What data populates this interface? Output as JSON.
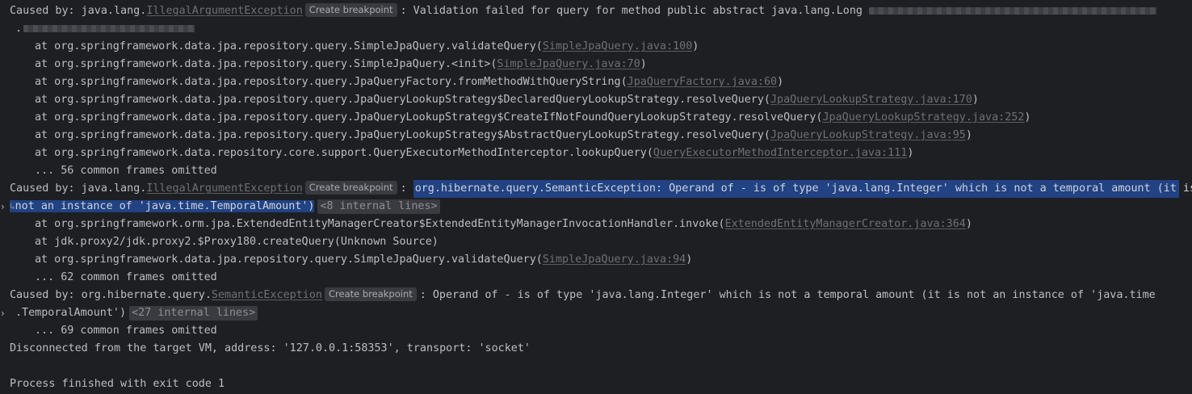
{
  "console": {
    "lines": [
      {
        "kind": "caused",
        "prefix": "Caused by: java.lang.",
        "exception": "IllegalArgumentException",
        "chip": "Create breakpoint",
        "message": ": Validation failed for query for method public abstract java.lang.Long"
      },
      {
        "kind": "cont",
        "text": "."
      },
      {
        "kind": "frame",
        "text": "at org.springframework.data.jpa.repository.query.SimpleJpaQuery.validateQuery(",
        "link": "SimpleJpaQuery.java:100",
        "suffix": ")"
      },
      {
        "kind": "frame",
        "text": "at org.springframework.data.jpa.repository.query.SimpleJpaQuery.<init>(",
        "link": "SimpleJpaQuery.java:70",
        "suffix": ")"
      },
      {
        "kind": "frame",
        "text": "at org.springframework.data.jpa.repository.query.JpaQueryFactory.fromMethodWithQueryString(",
        "link": "JpaQueryFactory.java:60",
        "suffix": ")"
      },
      {
        "kind": "frame",
        "text": "at org.springframework.data.jpa.repository.query.JpaQueryLookupStrategy$DeclaredQueryLookupStrategy.resolveQuery(",
        "link": "JpaQueryLookupStrategy.java:170",
        "suffix": ")"
      },
      {
        "kind": "frame",
        "text": "at org.springframework.data.jpa.repository.query.JpaQueryLookupStrategy$CreateIfNotFoundQueryLookupStrategy.resolveQuery(",
        "link": "JpaQueryLookupStrategy.java:252",
        "suffix": ")"
      },
      {
        "kind": "frame",
        "text": "at org.springframework.data.jpa.repository.query.JpaQueryLookupStrategy$AbstractQueryLookupStrategy.resolveQuery(",
        "link": "JpaQueryLookupStrategy.java:95",
        "suffix": ")"
      },
      {
        "kind": "frame",
        "text": "at org.springframework.data.repository.core.support.QueryExecutorMethodInterceptor.lookupQuery(",
        "link": "QueryExecutorMethodInterceptor.java:111",
        "suffix": ")"
      },
      {
        "kind": "omitted",
        "text": "... 56 common frames omitted"
      },
      {
        "kind": "caused-selected",
        "prefix": "Caused by: java.lang.",
        "exception": "IllegalArgumentException",
        "chip": "Create breakpoint",
        "colon": ":",
        "message": "org.hibernate.query.SemanticException: Operand of - is of type 'java.lang.Integer' which is not a temporal amount (it is"
      },
      {
        "kind": "cont-selected",
        "text": "not an instance of 'java.time.TemporalAmount')",
        "internal": "<8 internal lines>"
      },
      {
        "kind": "frame",
        "text": "at org.springframework.orm.jpa.ExtendedEntityManagerCreator$ExtendedEntityManagerInvocationHandler.invoke(",
        "link": "ExtendedEntityManagerCreator.java:364",
        "suffix": ")"
      },
      {
        "kind": "frame-plain",
        "text": "at jdk.proxy2/jdk.proxy2.$Proxy180.createQuery(Unknown Source)"
      },
      {
        "kind": "frame",
        "text": "at org.springframework.data.jpa.repository.query.SimpleJpaQuery.validateQuery(",
        "link": "SimpleJpaQuery.java:94",
        "suffix": ")"
      },
      {
        "kind": "omitted",
        "text": "... 62 common frames omitted"
      },
      {
        "kind": "caused",
        "prefix": "Caused by: org.hibernate.query.",
        "exception": "SemanticException",
        "chip": "Create breakpoint",
        "message": ": Operand of - is of type 'java.lang.Integer' which is not a temporal amount (it is not an instance of 'java.time"
      },
      {
        "kind": "cont-internal",
        "text": ".TemporalAmount')",
        "internal": "<27 internal lines>"
      },
      {
        "kind": "omitted",
        "text": "... 69 common frames omitted"
      },
      {
        "kind": "plain",
        "text": "Disconnected from the target VM, address: '127.0.0.1:58353', transport: 'socket'"
      },
      {
        "kind": "plain",
        "text": ""
      },
      {
        "kind": "plain",
        "text": "Process finished with exit code 1"
      }
    ]
  },
  "colors": {
    "background": "#1e1f22",
    "text": "#bcbec4",
    "link": "#6e7078",
    "selection": "#214283",
    "chip": "#393b40"
  }
}
